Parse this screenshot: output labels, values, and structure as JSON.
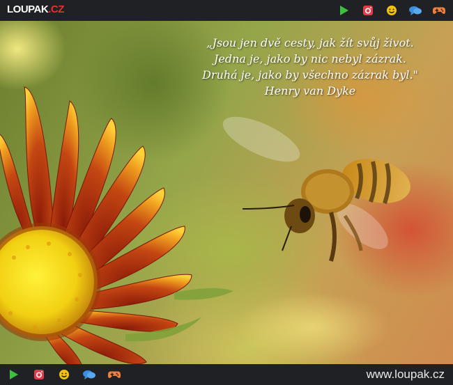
{
  "header": {
    "logo_main": "LOUPAK",
    "logo_suffix": ".CZ",
    "icons": [
      "play-icon",
      "instagram-icon",
      "smiley-icon",
      "chat-icon",
      "gamepad-icon"
    ]
  },
  "quote": {
    "lines": [
      "„Jsou jen dvě cesty, jak žít svůj život.",
      "Jedna je, jako by nic nebyl zázrak.",
      "Druhá je, jako by všechno zázrak byl.\"",
      "Henry van Dyke"
    ]
  },
  "footer": {
    "site_url": "www.loupak.cz",
    "icons": [
      "play-icon",
      "instagram-icon",
      "smiley-icon",
      "chat-icon",
      "gamepad-icon"
    ]
  },
  "colors": {
    "bar": "#1f2124",
    "play": "#3fbf3f",
    "instagram": "#e23c4a",
    "smiley": "#f4c20d",
    "chat": "#3b8fe0",
    "gamepad": "#f0803c"
  }
}
